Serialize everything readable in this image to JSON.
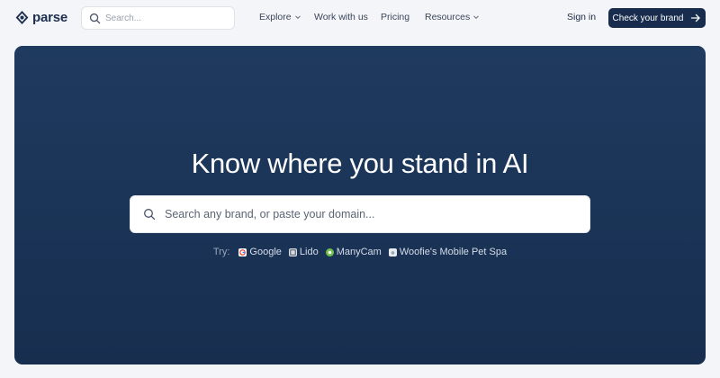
{
  "header": {
    "logo_text": "parse",
    "search_placeholder": "Search...",
    "nav": [
      {
        "label": "Explore",
        "has_dropdown": true
      },
      {
        "label": "Work with us",
        "has_dropdown": false
      },
      {
        "label": "Pricing",
        "has_dropdown": false
      },
      {
        "label": "Resources",
        "has_dropdown": true
      }
    ],
    "signin_label": "Sign in",
    "cta_label": "Check your brand"
  },
  "hero": {
    "title": "Know where you stand in AI",
    "search_placeholder": "Search any brand, or paste your domain...",
    "try_label": "Try:",
    "suggestions": [
      {
        "label": "Google",
        "icon": "google-icon",
        "color": "#ffffff"
      },
      {
        "label": "Lido",
        "icon": "lido-icon",
        "color": "#d9dde4"
      },
      {
        "label": "ManyCam",
        "icon": "manycam-icon",
        "color": "#6fbf4a"
      },
      {
        "label": "Woofie's Mobile Pet Spa",
        "icon": "woofies-icon",
        "color": "#e8ecf0"
      }
    ]
  },
  "colors": {
    "page_bg": "#f4f5f8",
    "hero_bg": "#1b3558",
    "cta_bg": "#182c4d",
    "text_primary": "#1a2b45"
  }
}
